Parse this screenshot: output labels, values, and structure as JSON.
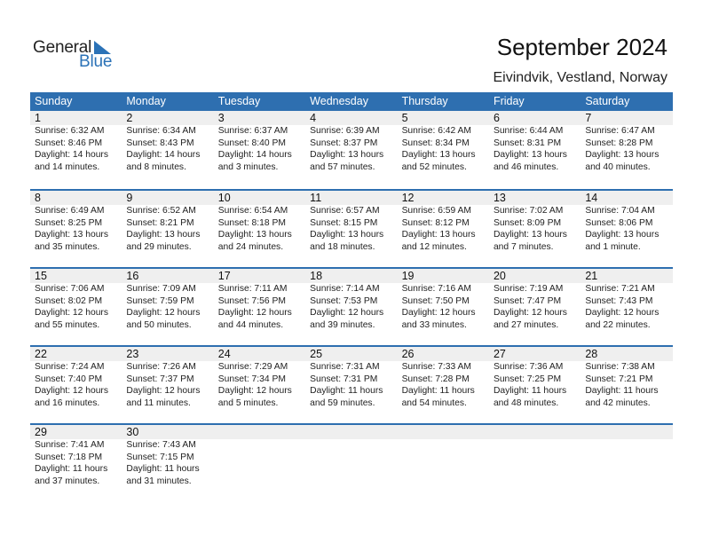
{
  "logo": {
    "word1": "General",
    "word2": "Blue"
  },
  "header": {
    "title": "September 2024",
    "location": "Eivindvik, Vestland, Norway"
  },
  "colors": {
    "accent": "#2e6fb0",
    "date_strip": "#efefef"
  },
  "weekdays": [
    "Sunday",
    "Monday",
    "Tuesday",
    "Wednesday",
    "Thursday",
    "Friday",
    "Saturday"
  ],
  "weeks": [
    [
      {
        "day": "1",
        "sunrise": "Sunrise: 6:32 AM",
        "sunset": "Sunset: 8:46 PM",
        "daylight1": "Daylight: 14 hours",
        "daylight2": "and 14 minutes."
      },
      {
        "day": "2",
        "sunrise": "Sunrise: 6:34 AM",
        "sunset": "Sunset: 8:43 PM",
        "daylight1": "Daylight: 14 hours",
        "daylight2": "and 8 minutes."
      },
      {
        "day": "3",
        "sunrise": "Sunrise: 6:37 AM",
        "sunset": "Sunset: 8:40 PM",
        "daylight1": "Daylight: 14 hours",
        "daylight2": "and 3 minutes."
      },
      {
        "day": "4",
        "sunrise": "Sunrise: 6:39 AM",
        "sunset": "Sunset: 8:37 PM",
        "daylight1": "Daylight: 13 hours",
        "daylight2": "and 57 minutes."
      },
      {
        "day": "5",
        "sunrise": "Sunrise: 6:42 AM",
        "sunset": "Sunset: 8:34 PM",
        "daylight1": "Daylight: 13 hours",
        "daylight2": "and 52 minutes."
      },
      {
        "day": "6",
        "sunrise": "Sunrise: 6:44 AM",
        "sunset": "Sunset: 8:31 PM",
        "daylight1": "Daylight: 13 hours",
        "daylight2": "and 46 minutes."
      },
      {
        "day": "7",
        "sunrise": "Sunrise: 6:47 AM",
        "sunset": "Sunset: 8:28 PM",
        "daylight1": "Daylight: 13 hours",
        "daylight2": "and 40 minutes."
      }
    ],
    [
      {
        "day": "8",
        "sunrise": "Sunrise: 6:49 AM",
        "sunset": "Sunset: 8:25 PM",
        "daylight1": "Daylight: 13 hours",
        "daylight2": "and 35 minutes."
      },
      {
        "day": "9",
        "sunrise": "Sunrise: 6:52 AM",
        "sunset": "Sunset: 8:21 PM",
        "daylight1": "Daylight: 13 hours",
        "daylight2": "and 29 minutes."
      },
      {
        "day": "10",
        "sunrise": "Sunrise: 6:54 AM",
        "sunset": "Sunset: 8:18 PM",
        "daylight1": "Daylight: 13 hours",
        "daylight2": "and 24 minutes."
      },
      {
        "day": "11",
        "sunrise": "Sunrise: 6:57 AM",
        "sunset": "Sunset: 8:15 PM",
        "daylight1": "Daylight: 13 hours",
        "daylight2": "and 18 minutes."
      },
      {
        "day": "12",
        "sunrise": "Sunrise: 6:59 AM",
        "sunset": "Sunset: 8:12 PM",
        "daylight1": "Daylight: 13 hours",
        "daylight2": "and 12 minutes."
      },
      {
        "day": "13",
        "sunrise": "Sunrise: 7:02 AM",
        "sunset": "Sunset: 8:09 PM",
        "daylight1": "Daylight: 13 hours",
        "daylight2": "and 7 minutes."
      },
      {
        "day": "14",
        "sunrise": "Sunrise: 7:04 AM",
        "sunset": "Sunset: 8:06 PM",
        "daylight1": "Daylight: 13 hours",
        "daylight2": "and 1 minute."
      }
    ],
    [
      {
        "day": "15",
        "sunrise": "Sunrise: 7:06 AM",
        "sunset": "Sunset: 8:02 PM",
        "daylight1": "Daylight: 12 hours",
        "daylight2": "and 55 minutes."
      },
      {
        "day": "16",
        "sunrise": "Sunrise: 7:09 AM",
        "sunset": "Sunset: 7:59 PM",
        "daylight1": "Daylight: 12 hours",
        "daylight2": "and 50 minutes."
      },
      {
        "day": "17",
        "sunrise": "Sunrise: 7:11 AM",
        "sunset": "Sunset: 7:56 PM",
        "daylight1": "Daylight: 12 hours",
        "daylight2": "and 44 minutes."
      },
      {
        "day": "18",
        "sunrise": "Sunrise: 7:14 AM",
        "sunset": "Sunset: 7:53 PM",
        "daylight1": "Daylight: 12 hours",
        "daylight2": "and 39 minutes."
      },
      {
        "day": "19",
        "sunrise": "Sunrise: 7:16 AM",
        "sunset": "Sunset: 7:50 PM",
        "daylight1": "Daylight: 12 hours",
        "daylight2": "and 33 minutes."
      },
      {
        "day": "20",
        "sunrise": "Sunrise: 7:19 AM",
        "sunset": "Sunset: 7:47 PM",
        "daylight1": "Daylight: 12 hours",
        "daylight2": "and 27 minutes."
      },
      {
        "day": "21",
        "sunrise": "Sunrise: 7:21 AM",
        "sunset": "Sunset: 7:43 PM",
        "daylight1": "Daylight: 12 hours",
        "daylight2": "and 22 minutes."
      }
    ],
    [
      {
        "day": "22",
        "sunrise": "Sunrise: 7:24 AM",
        "sunset": "Sunset: 7:40 PM",
        "daylight1": "Daylight: 12 hours",
        "daylight2": "and 16 minutes."
      },
      {
        "day": "23",
        "sunrise": "Sunrise: 7:26 AM",
        "sunset": "Sunset: 7:37 PM",
        "daylight1": "Daylight: 12 hours",
        "daylight2": "and 11 minutes."
      },
      {
        "day": "24",
        "sunrise": "Sunrise: 7:29 AM",
        "sunset": "Sunset: 7:34 PM",
        "daylight1": "Daylight: 12 hours",
        "daylight2": "and 5 minutes."
      },
      {
        "day": "25",
        "sunrise": "Sunrise: 7:31 AM",
        "sunset": "Sunset: 7:31 PM",
        "daylight1": "Daylight: 11 hours",
        "daylight2": "and 59 minutes."
      },
      {
        "day": "26",
        "sunrise": "Sunrise: 7:33 AM",
        "sunset": "Sunset: 7:28 PM",
        "daylight1": "Daylight: 11 hours",
        "daylight2": "and 54 minutes."
      },
      {
        "day": "27",
        "sunrise": "Sunrise: 7:36 AM",
        "sunset": "Sunset: 7:25 PM",
        "daylight1": "Daylight: 11 hours",
        "daylight2": "and 48 minutes."
      },
      {
        "day": "28",
        "sunrise": "Sunrise: 7:38 AM",
        "sunset": "Sunset: 7:21 PM",
        "daylight1": "Daylight: 11 hours",
        "daylight2": "and 42 minutes."
      }
    ],
    [
      {
        "day": "29",
        "sunrise": "Sunrise: 7:41 AM",
        "sunset": "Sunset: 7:18 PM",
        "daylight1": "Daylight: 11 hours",
        "daylight2": "and 37 minutes."
      },
      {
        "day": "30",
        "sunrise": "Sunrise: 7:43 AM",
        "sunset": "Sunset: 7:15 PM",
        "daylight1": "Daylight: 11 hours",
        "daylight2": "and 31 minutes."
      },
      null,
      null,
      null,
      null,
      null
    ]
  ]
}
